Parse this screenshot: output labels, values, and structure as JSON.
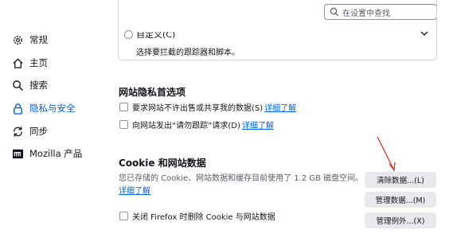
{
  "search": {
    "placeholder": "在设置中查找"
  },
  "sidebar": {
    "items": [
      {
        "label": "常规",
        "icon": "gear-icon"
      },
      {
        "label": "主页",
        "icon": "home-icon"
      },
      {
        "label": "搜索",
        "icon": "search-icon"
      },
      {
        "label": "隐私与安全",
        "icon": "lock-icon",
        "selected": true
      },
      {
        "label": "同步",
        "icon": "sync-icon"
      },
      {
        "label": "Mozilla 产品",
        "icon": "mozilla-logo-icon"
      }
    ]
  },
  "tracking": {
    "custom_label": "自定义(C)",
    "custom_desc": "选择要拦截的跟踪器和脚本。"
  },
  "privacy_prefs": {
    "title": "网站隐私首选项",
    "gpc_label": "要求网站不许出售或共享我的数据(S)",
    "gpc_link": "详细了解",
    "dnt_label": "向网站发出“请勿跟踪”请求(D)",
    "dnt_link": "详细了解"
  },
  "cookies": {
    "title": "Cookie 和网站数据",
    "desc": "您已存储的 Cookie、网站数据和缓存目前使用了 1.2 GB 磁盘空间。",
    "learn_more": "详细了解",
    "clear_button": "清除数据...(L)",
    "manage_button": "管理数据...(M)",
    "exceptions_button": "管理例外...(X)",
    "delete_on_close_label": "关闭 Firefox 时删除 Cookie 与网站数据"
  },
  "colors": {
    "accent": "#0061e0",
    "arrow": "#e0301e"
  }
}
